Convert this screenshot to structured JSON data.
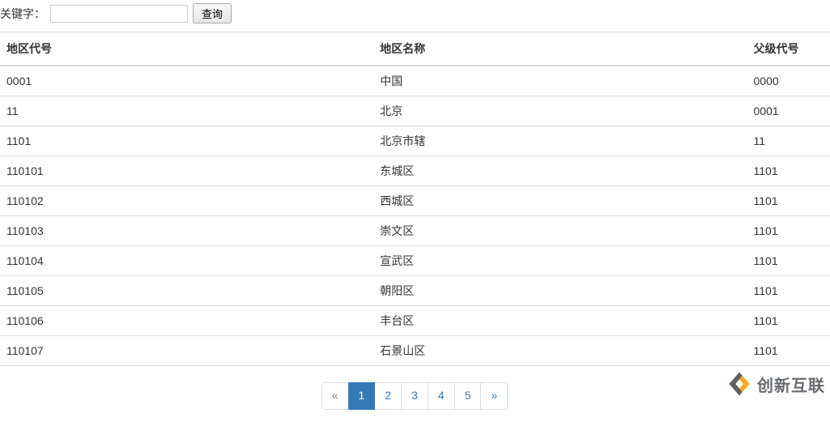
{
  "search": {
    "label": "关键字：",
    "value": "",
    "button": "查询"
  },
  "table": {
    "headers": [
      "地区代号",
      "地区名称",
      "父级代号"
    ],
    "rows": [
      {
        "code": "0001",
        "name": "中国",
        "parent": "0000"
      },
      {
        "code": "11",
        "name": "北京",
        "parent": "0001"
      },
      {
        "code": "1101",
        "name": "北京市辖",
        "parent": "11"
      },
      {
        "code": "110101",
        "name": "东城区",
        "parent": "1101"
      },
      {
        "code": "110102",
        "name": "西城区",
        "parent": "1101"
      },
      {
        "code": "110103",
        "name": "崇文区",
        "parent": "1101"
      },
      {
        "code": "110104",
        "name": "宣武区",
        "parent": "1101"
      },
      {
        "code": "110105",
        "name": "朝阳区",
        "parent": "1101"
      },
      {
        "code": "110106",
        "name": "丰台区",
        "parent": "1101"
      },
      {
        "code": "110107",
        "name": "石景山区",
        "parent": "1101"
      }
    ]
  },
  "pagination": {
    "prev": "«",
    "next": "»",
    "pages": [
      "1",
      "2",
      "3",
      "4",
      "5"
    ],
    "active": "1"
  },
  "watermark": {
    "text": "创新互联"
  }
}
